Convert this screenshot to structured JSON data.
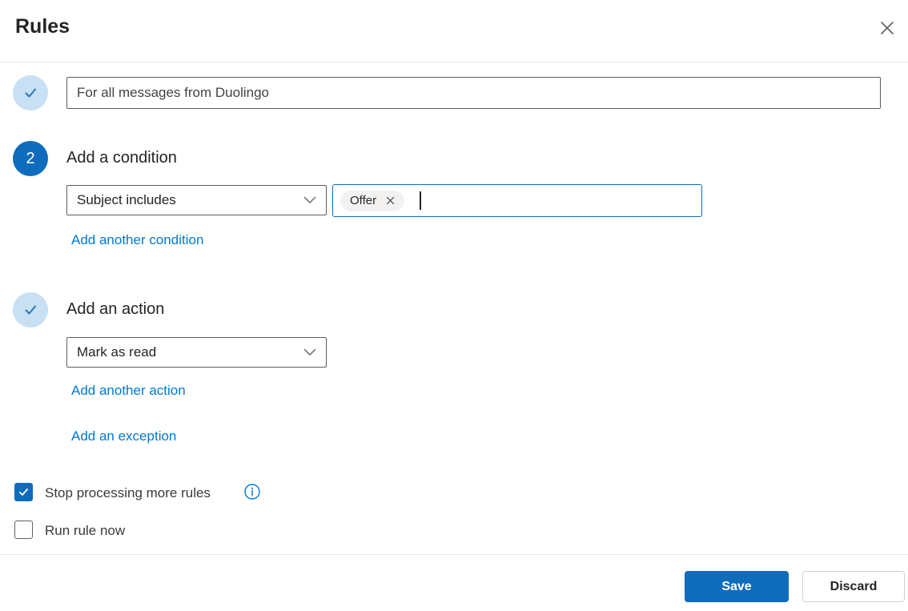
{
  "dialog": {
    "title": "Rules"
  },
  "rule_name": {
    "value": "For all messages from Duolingo"
  },
  "condition": {
    "step_number": "2",
    "heading": "Add a condition",
    "selected_option": "Subject includes",
    "value_chip": "Offer",
    "add_another_label": "Add another condition"
  },
  "action": {
    "heading": "Add an action",
    "selected_option": "Mark as read",
    "add_another_label": "Add another action",
    "add_exception_label": "Add an exception"
  },
  "options": {
    "stop_processing": {
      "label": "Stop processing more rules",
      "checked": true
    },
    "run_rule_now": {
      "label": "Run rule now",
      "checked": false
    }
  },
  "footer": {
    "save_label": "Save",
    "discard_label": "Discard"
  },
  "icons": {
    "close": "close-icon",
    "chevron": "chevron-down-icon",
    "checkmark": "checkmark-icon",
    "info": "info-icon",
    "chip_remove": "remove-tag-icon"
  },
  "colors": {
    "brand_blue": "#0f6cbd",
    "link_blue": "#0078d4",
    "light_circle_blue": "#c7e0f4",
    "input_border": "#605e5c",
    "divider": "#e8e8e8",
    "chip_background": "#f3f2f1",
    "text_dark": "#242424",
    "text_gray": "#424242"
  }
}
